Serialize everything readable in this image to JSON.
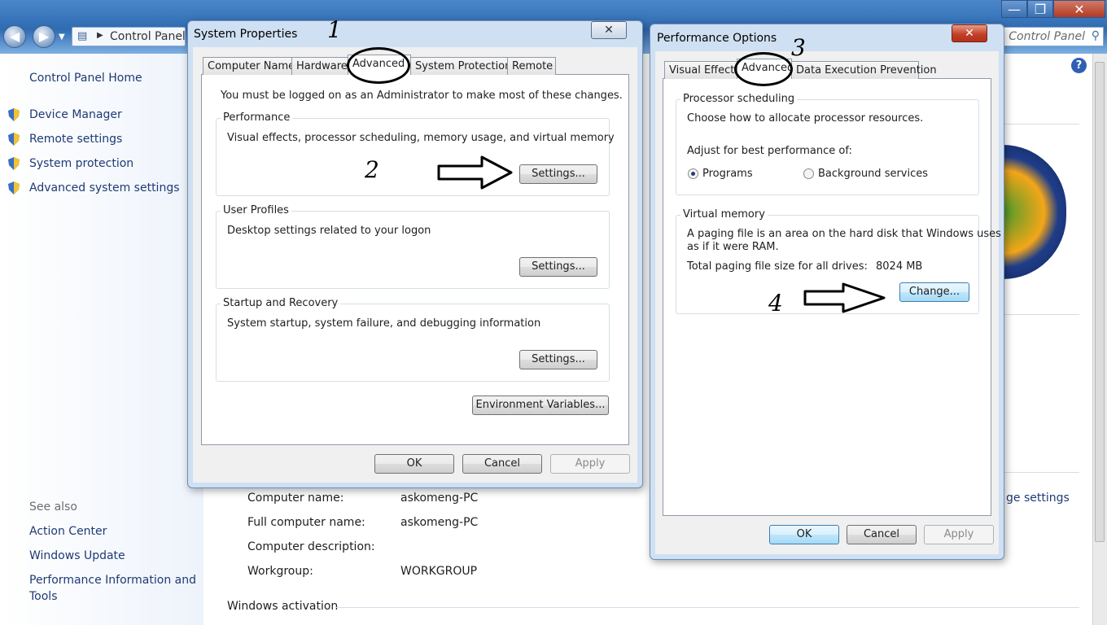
{
  "address": {
    "breadcrumb": "Control Panel",
    "search_placeholder": "Search Control Panel"
  },
  "window_controls": {
    "minimize": "—",
    "maximize": "❐",
    "close": "✕"
  },
  "sidebar": {
    "home": "Control Panel Home",
    "items": [
      {
        "label": "Device Manager"
      },
      {
        "label": "Remote settings"
      },
      {
        "label": "System protection"
      },
      {
        "label": "Advanced system settings"
      }
    ],
    "see_also_title": "See also",
    "see_also": [
      {
        "label": "Action Center"
      },
      {
        "label": "Windows Update"
      },
      {
        "label": "Performance Information and"
      },
      {
        "label": "Tools"
      }
    ]
  },
  "main": {
    "computer_name_label": "Computer name:",
    "computer_name": "askomeng-PC",
    "full_name_label": "Full computer name:",
    "full_name": "askomeng-PC",
    "description_label": "Computer description:",
    "workgroup_label": "Workgroup:",
    "workgroup": "WORKGROUP",
    "activation_title": "Windows activation",
    "change_settings_link": "ge settings"
  },
  "sysprops": {
    "title": "System Properties",
    "close": "✕",
    "tabs": [
      "Computer Name",
      "Hardware",
      "Advanced",
      "System Protection",
      "Remote"
    ],
    "admin_note": "You must be logged on as an Administrator to make most of these changes.",
    "performance": {
      "title": "Performance",
      "desc": "Visual effects, processor scheduling, memory usage, and virtual memory",
      "button": "Settings..."
    },
    "profiles": {
      "title": "User Profiles",
      "desc": "Desktop settings related to your logon",
      "button": "Settings..."
    },
    "startup": {
      "title": "Startup and Recovery",
      "desc": "System startup, system failure, and debugging information",
      "button": "Settings..."
    },
    "env_button": "Environment Variables...",
    "ok": "OK",
    "cancel": "Cancel",
    "apply": "Apply"
  },
  "perfopts": {
    "title": "Performance Options",
    "close": "✕",
    "tabs": [
      "Visual Effects",
      "Advanced",
      "Data Execution Prevention"
    ],
    "scheduling": {
      "title": "Processor scheduling",
      "desc": "Choose how to allocate processor resources.",
      "adjust": "Adjust for best performance of:",
      "opt_programs": "Programs",
      "opt_background": "Background services"
    },
    "vm": {
      "title": "Virtual memory",
      "line1": "A paging file is an area on the hard disk that Windows uses",
      "line2": "as if it were RAM.",
      "total_label": "Total paging file size for all drives:",
      "total_value": "8024 MB",
      "change": "Change..."
    },
    "ok": "OK",
    "cancel": "Cancel",
    "apply": "Apply"
  },
  "annotations": {
    "n1": "1",
    "n2": "2",
    "n3": "3",
    "n4": "4"
  }
}
